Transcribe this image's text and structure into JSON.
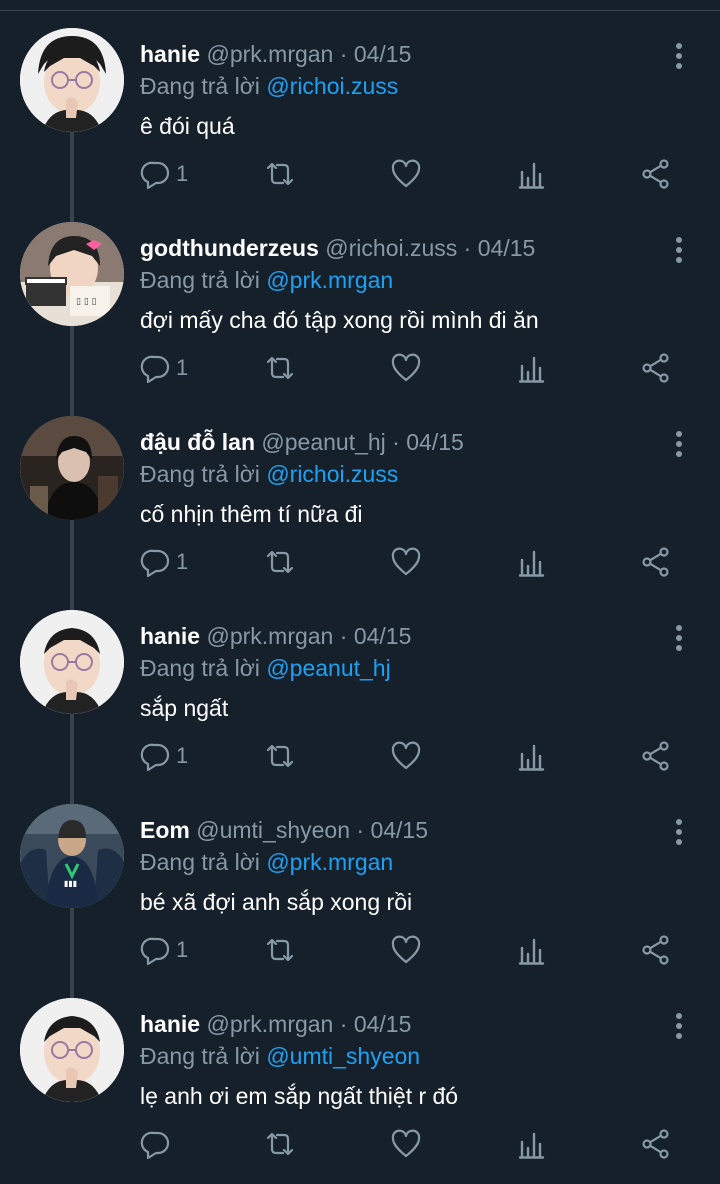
{
  "colors": {
    "background": "#15202b",
    "muted": "#8899a6",
    "accent": "#1da1f2",
    "divider": "#38444d"
  },
  "reply_prefix": "Đang trả lời",
  "tweets": [
    {
      "name": "hanie",
      "handle": "@prk.mrgan",
      "date": "04/15",
      "reply_to": "@richoi.zuss",
      "text": "ê đói quá",
      "reply_count": "1",
      "avatar": "avatar-glasses"
    },
    {
      "name": "godthunderzeus",
      "handle": "@richoi.zuss",
      "date": "04/15",
      "reply_to": "@prk.mrgan",
      "text": "đợi mấy cha đó tập xong rồi mình đi ăn",
      "reply_count": "1",
      "avatar": "avatar-clapperboard"
    },
    {
      "name": "đậu đỗ lan",
      "handle": "@peanut_hj",
      "date": "04/15",
      "reply_to": "@richoi.zuss",
      "text": "cố nhịn thêm tí nữa đi",
      "reply_count": "1",
      "avatar": "avatar-dark"
    },
    {
      "name": "hanie",
      "handle": "@prk.mrgan",
      "date": "04/15",
      "reply_to": "@peanut_hj",
      "text": "sắp ngất",
      "reply_count": "1",
      "avatar": "avatar-glasses"
    },
    {
      "name": "Eom",
      "handle": "@umti_shyeon",
      "date": "04/15",
      "reply_to": "@prk.mrgan",
      "text": "bé xã đợi anh sắp xong rồi",
      "reply_count": "1",
      "avatar": "avatar-team"
    },
    {
      "name": "hanie",
      "handle": "@prk.mrgan",
      "date": "04/15",
      "reply_to": "@umti_shyeon",
      "text": "lẹ anh ơi em sắp ngất thiệt r đó",
      "reply_count": "",
      "avatar": "avatar-glasses"
    }
  ]
}
